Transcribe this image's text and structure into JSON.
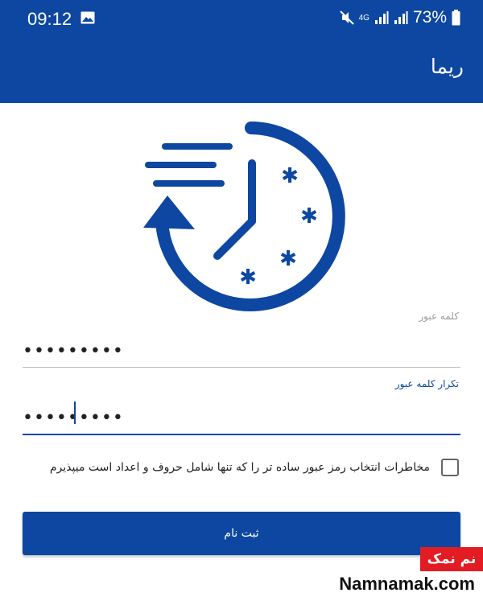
{
  "status_bar": {
    "time": "09:12",
    "network": "4G",
    "battery": "73%",
    "icons": [
      "gallery-icon",
      "mute-icon",
      "signal-icon",
      "signal-icon",
      "battery-icon"
    ]
  },
  "app_bar": {
    "title": "ریما"
  },
  "logo": {
    "icon": "clock-history-icon",
    "color": "#0d47a1"
  },
  "form": {
    "password": {
      "label": "کلمه عبور",
      "value": "•••••••••"
    },
    "confirm_password": {
      "label": "تکرار کلمه عبور",
      "value": "•••••••••"
    },
    "agree": {
      "label": "مخاطرات انتخاب رمز عبور ساده تر را که تنها شامل حروف و اعداد است میپذیرم",
      "checked": false
    },
    "submit_label": "ثبت نام"
  },
  "watermark": {
    "badge": "نم نمک",
    "site": "Namnamak.com"
  },
  "colors": {
    "primary": "#0d47a1",
    "watermark": "#e31b23"
  }
}
